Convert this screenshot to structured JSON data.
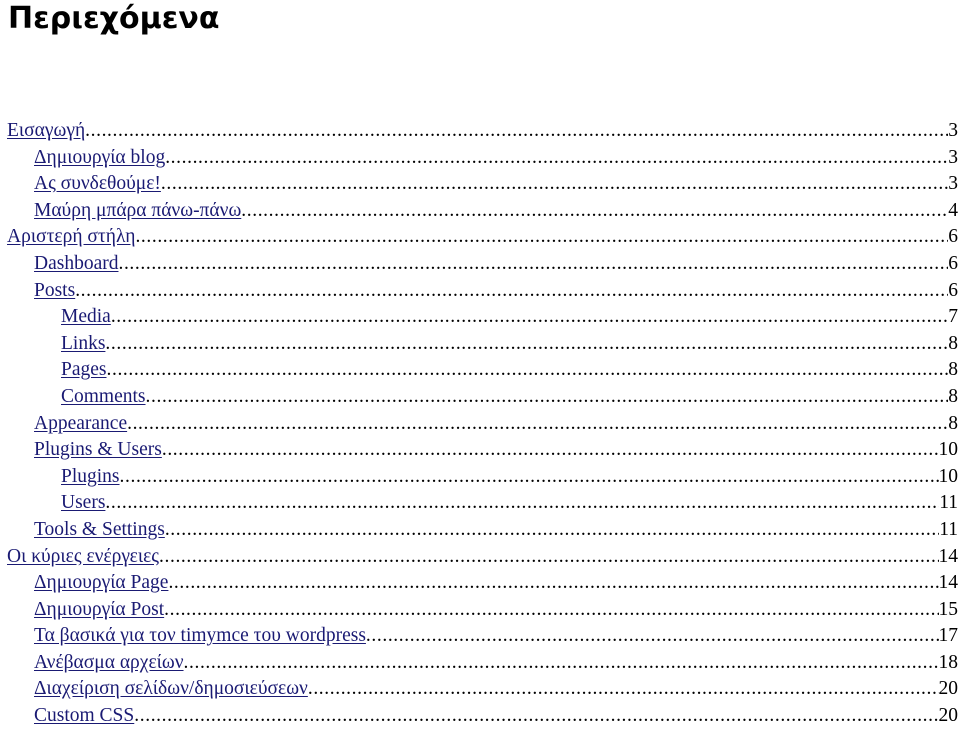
{
  "document": {
    "title": "Περιεχόμενα",
    "toc": [
      {
        "label": "Εισαγωγή",
        "page": "3",
        "level": 1
      },
      {
        "label": "Δημιουργία blog",
        "page": "3",
        "level": 2
      },
      {
        "label": "Ας συνδεθούμε!",
        "page": "3",
        "level": 2
      },
      {
        "label": "Μαύρη μπάρα πάνω-πάνω",
        "page": "4",
        "level": 2
      },
      {
        "label": "Αριστερή στήλη",
        "page": "6",
        "level": 1
      },
      {
        "label": "Dashboard",
        "page": "6",
        "level": 2
      },
      {
        "label": "Posts",
        "page": "6",
        "level": 2
      },
      {
        "label": "Media",
        "page": "7",
        "level": 3
      },
      {
        "label": "Links",
        "page": "8",
        "level": 3
      },
      {
        "label": "Pages",
        "page": "8",
        "level": 3
      },
      {
        "label": "Comments",
        "page": "8",
        "level": 3
      },
      {
        "label": "Appearance",
        "page": "8",
        "level": 2
      },
      {
        "label": "Plugins & Users",
        "page": "10",
        "level": 2
      },
      {
        "label": "Plugins",
        "page": "10",
        "level": 3
      },
      {
        "label": "Users",
        "page": "11",
        "level": 3
      },
      {
        "label": "Tools & Settings",
        "page": "11",
        "level": 2
      },
      {
        "label": "Οι κύριες ενέργειες",
        "page": "14",
        "level": 1
      },
      {
        "label": "Δημιουργία Page",
        "page": "14",
        "level": 2
      },
      {
        "label": "Δημιουργία Post",
        "page": "15",
        "level": 2
      },
      {
        "label": "Τα βασικά για τον timymce του wordpress",
        "page": "17",
        "level": 2
      },
      {
        "label": "Ανέβασμα αρχείων",
        "page": "18",
        "level": 2
      },
      {
        "label": "Διαχείριση σελίδων/δημοσιεύσεων",
        "page": "20",
        "level": 2
      },
      {
        "label": "Custom CSS",
        "page": "20",
        "level": 2
      }
    ]
  },
  "colors": {
    "link": "#1a1a73",
    "text": "#000000",
    "background": "#ffffff"
  }
}
